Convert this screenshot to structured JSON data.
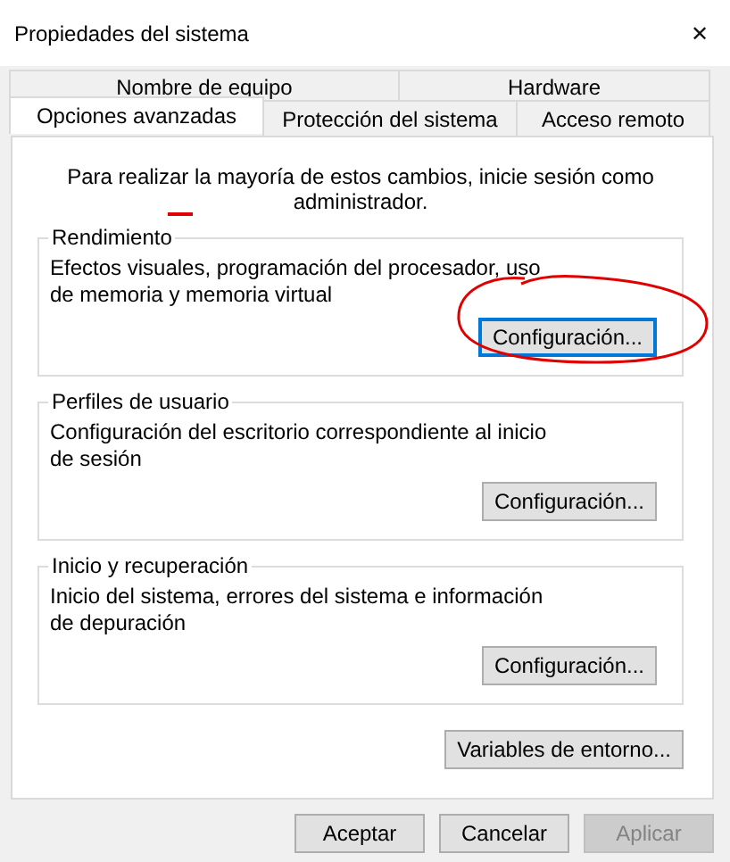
{
  "window": {
    "title": "Propiedades del sistema",
    "close": "✕"
  },
  "tab_rows": [
    [
      {
        "label": "Nombre de equipo",
        "selected": false
      },
      {
        "label": "Hardware",
        "selected": false
      }
    ],
    [
      {
        "label": "Opciones avanzadas",
        "selected": true
      },
      {
        "label": "Protección del sistema",
        "selected": false
      },
      {
        "label": "Acceso remoto",
        "selected": false
      }
    ]
  ],
  "notice": "Para realizar la mayoría de estos cambios, inicie sesión como administrador.",
  "groups": [
    {
      "title": "Rendimiento",
      "text": "Efectos visuales, programación del procesador, uso de memoria y memoria virtual",
      "button": {
        "label": "Configuración...",
        "focused": true
      }
    },
    {
      "title": "Perfiles de usuario",
      "text": "Configuración del escritorio correspondiente al inicio de sesión",
      "button": {
        "label": "Configuración...",
        "focused": false
      }
    },
    {
      "title": "Inicio y recuperación",
      "text": "Inicio del sistema, errores del sistema e información de depuración",
      "button": {
        "label": "Configuración...",
        "focused": false
      }
    }
  ],
  "env_button": {
    "label": "Variables de entorno..."
  },
  "footer_buttons": [
    {
      "label": "Aceptar",
      "disabled": false
    },
    {
      "label": "Cancelar",
      "disabled": false
    },
    {
      "label": "Aplicar",
      "disabled": true
    }
  ]
}
